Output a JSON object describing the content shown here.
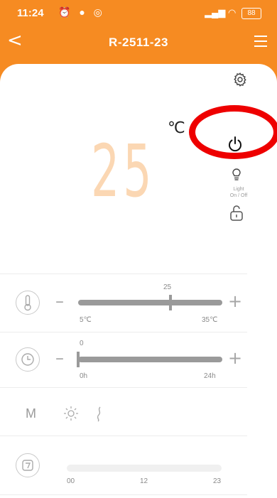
{
  "status_bar": {
    "time": "11:24",
    "battery": "88"
  },
  "nav": {
    "back": "<",
    "title": "R-2511-23"
  },
  "display": {
    "temperature": "25",
    "unit": "℃"
  },
  "side_controls": {
    "light_label_line1": "Light",
    "light_label_line2": "On / Off"
  },
  "temperature_slider": {
    "value": "25",
    "min_label": "5℃",
    "max_label": "35℃",
    "minus": "–",
    "plus": "+",
    "fraction": 0.64
  },
  "timer_slider": {
    "value": "0",
    "min_label": "0h",
    "max_label": "24h",
    "minus": "–",
    "plus": "+",
    "fraction": 0.0
  },
  "mode": {
    "letter": "M"
  },
  "schedule": {
    "tick_start": "00",
    "tick_mid": "12",
    "tick_end": "23"
  },
  "colors": {
    "accent": "#f68b22",
    "highlight_ring": "#ee0000",
    "temp_digits": "#fbd7b3"
  }
}
